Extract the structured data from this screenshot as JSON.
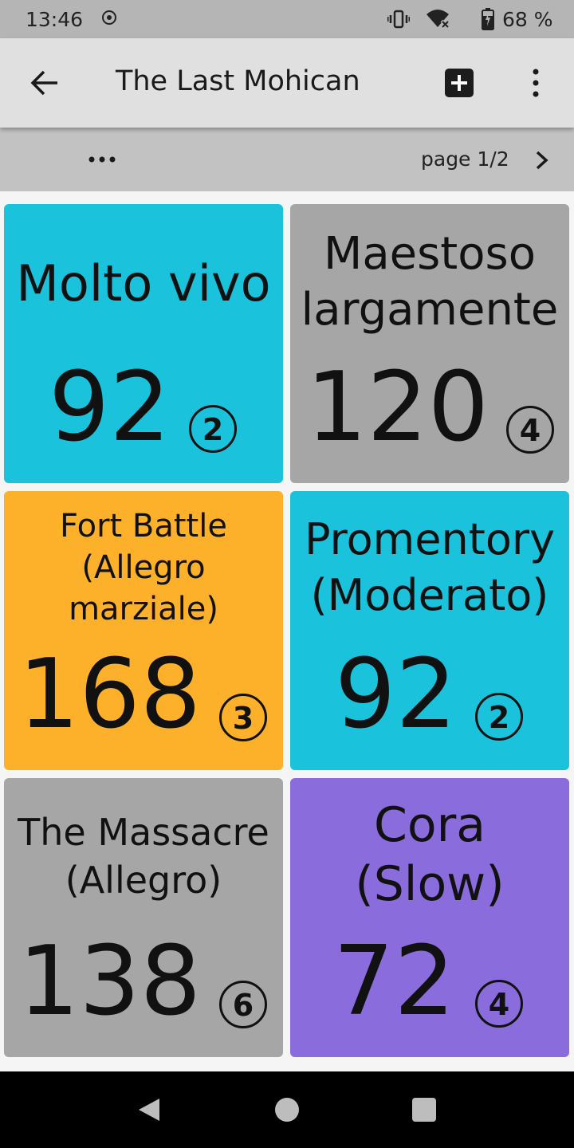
{
  "status_bar": {
    "time": "13:46",
    "battery_text": "68 %",
    "icons": [
      "circle-dot-icon",
      "vibrate-icon",
      "wifi-icon",
      "battery-icon"
    ]
  },
  "app_bar": {
    "title": "The Last Mohican",
    "icons": [
      "back-arrow-icon",
      "add-box-icon",
      "more-vertical-icon"
    ]
  },
  "page_nav": {
    "page_label": "page 1/2",
    "icons": [
      "more-horizontal-icon",
      "chevron-right-icon"
    ]
  },
  "tiles": [
    {
      "name": "Molto vivo",
      "bpm": "92",
      "beats": "2",
      "color": "#1ac2dc"
    },
    {
      "name": "Maestoso\nlargamente",
      "bpm": "120",
      "beats": "4",
      "color": "#a6a6a6"
    },
    {
      "name": "Fort Battle\n(Allegro\nmarziale)",
      "bpm": "168",
      "beats": "3",
      "color": "#fdb12a"
    },
    {
      "name": "Promentory\n(Moderato)",
      "bpm": "92",
      "beats": "2",
      "color": "#1ac2dc"
    },
    {
      "name": "The Massacre\n(Allegro)",
      "bpm": "138",
      "beats": "6",
      "color": "#a6a6a6"
    },
    {
      "name": "Cora\n(Slow)",
      "bpm": "72",
      "beats": "4",
      "color": "#8a6cdc"
    }
  ],
  "system_nav": {
    "icons": [
      "nav-back-icon",
      "nav-home-icon",
      "nav-recents-icon"
    ]
  }
}
